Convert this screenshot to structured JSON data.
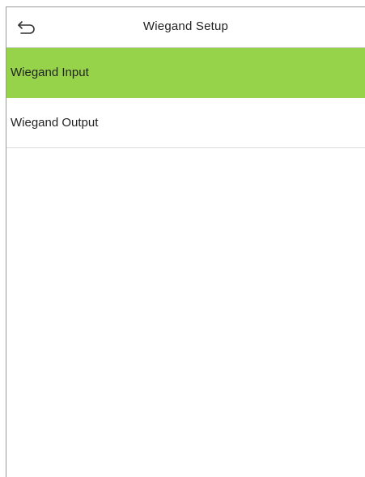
{
  "header": {
    "title": "Wiegand Setup",
    "back_icon": "back-arrow-icon"
  },
  "menu": {
    "items": [
      {
        "label": "Wiegand Input",
        "selected": true
      },
      {
        "label": "Wiegand Output",
        "selected": false
      }
    ]
  },
  "colors": {
    "selected_background": "#96d34b",
    "text": "#222222",
    "divider": "#dcdcdc"
  }
}
